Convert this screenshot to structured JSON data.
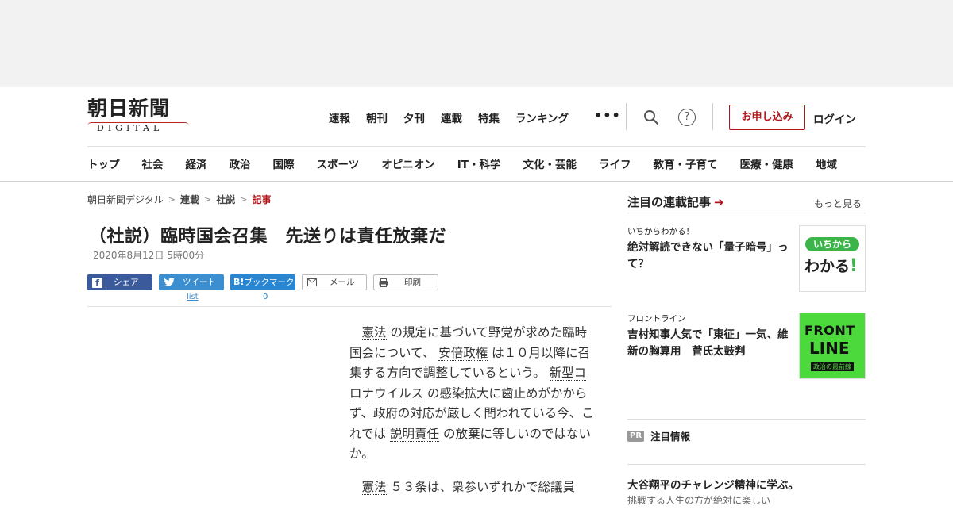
{
  "header": {
    "logo_text": "朝日新聞",
    "logo_sub": "DIGITAL",
    "top_nav": [
      "速報",
      "朝刊",
      "夕刊",
      "連載",
      "特集",
      "ランキング"
    ],
    "more_label": "•••",
    "apply_label": "お申し込み",
    "login_label": "ログイン",
    "categories": [
      "トップ",
      "社会",
      "経済",
      "政治",
      "国際",
      "スポーツ",
      "オピニオン",
      "IT・科学",
      "文化・芸能",
      "ライフ",
      "教育・子育て",
      "医療・健康",
      "地域"
    ]
  },
  "breadcrumb": [
    "朝日新聞デジタル",
    "連載",
    "社説",
    "記事"
  ],
  "article": {
    "title": "（社説）臨時国会召集　先送りは責任放棄だ",
    "date": "2020年8月12日 5時00分",
    "share": {
      "facebook": "シェア",
      "twitter": "ツイート",
      "twitter_count": "list",
      "hatena_prefix": "B!",
      "hatena": "ブックマーク",
      "hatena_count": "0",
      "mail": "メール",
      "print": "印刷"
    },
    "p1": {
      "a_link": "憲法",
      "a_text": "の規定に基づいて野党が求めた臨時国会について、",
      "b_link": "安倍政権",
      "b_text": "は１０月以降に召集する方向で調整しているという。",
      "c_link": "新型コロナウイルス",
      "c_text": "の感染拡大に歯止めがかからず、政府の対応が厳しく問われている今、これでは",
      "d_link": "説明責任",
      "d_text": "の放棄に等しいのではないか。"
    },
    "p2": {
      "a_link": "憲法",
      "a_text": "５３条は、衆参いずれかで総議員"
    }
  },
  "sidebar": {
    "heading": "注目の連載記事",
    "heading_arrow": "➔",
    "more": "もっと見る",
    "cards": [
      {
        "kicker": "いちからわかる！",
        "title": "絶対解読できない「量子暗号」って？",
        "thumb_top": "いちから",
        "thumb_main": "わかる",
        "thumb_mark": "!"
      },
      {
        "kicker": "フロントライン",
        "title": "吉村知事人気で「東征」一気、維新の胸算用　菅氏太鼓判",
        "thumb_top": "FRONT",
        "thumb_main": "LINE",
        "thumb_sub": "政治の最前線"
      }
    ],
    "pr_badge": "PR",
    "pr_label": "注目情報",
    "bottom_title": "大谷翔平のチャレンジ精神に学ぶ。",
    "bottom_sub": "挑戦する人生の方が絶対に楽しい"
  }
}
